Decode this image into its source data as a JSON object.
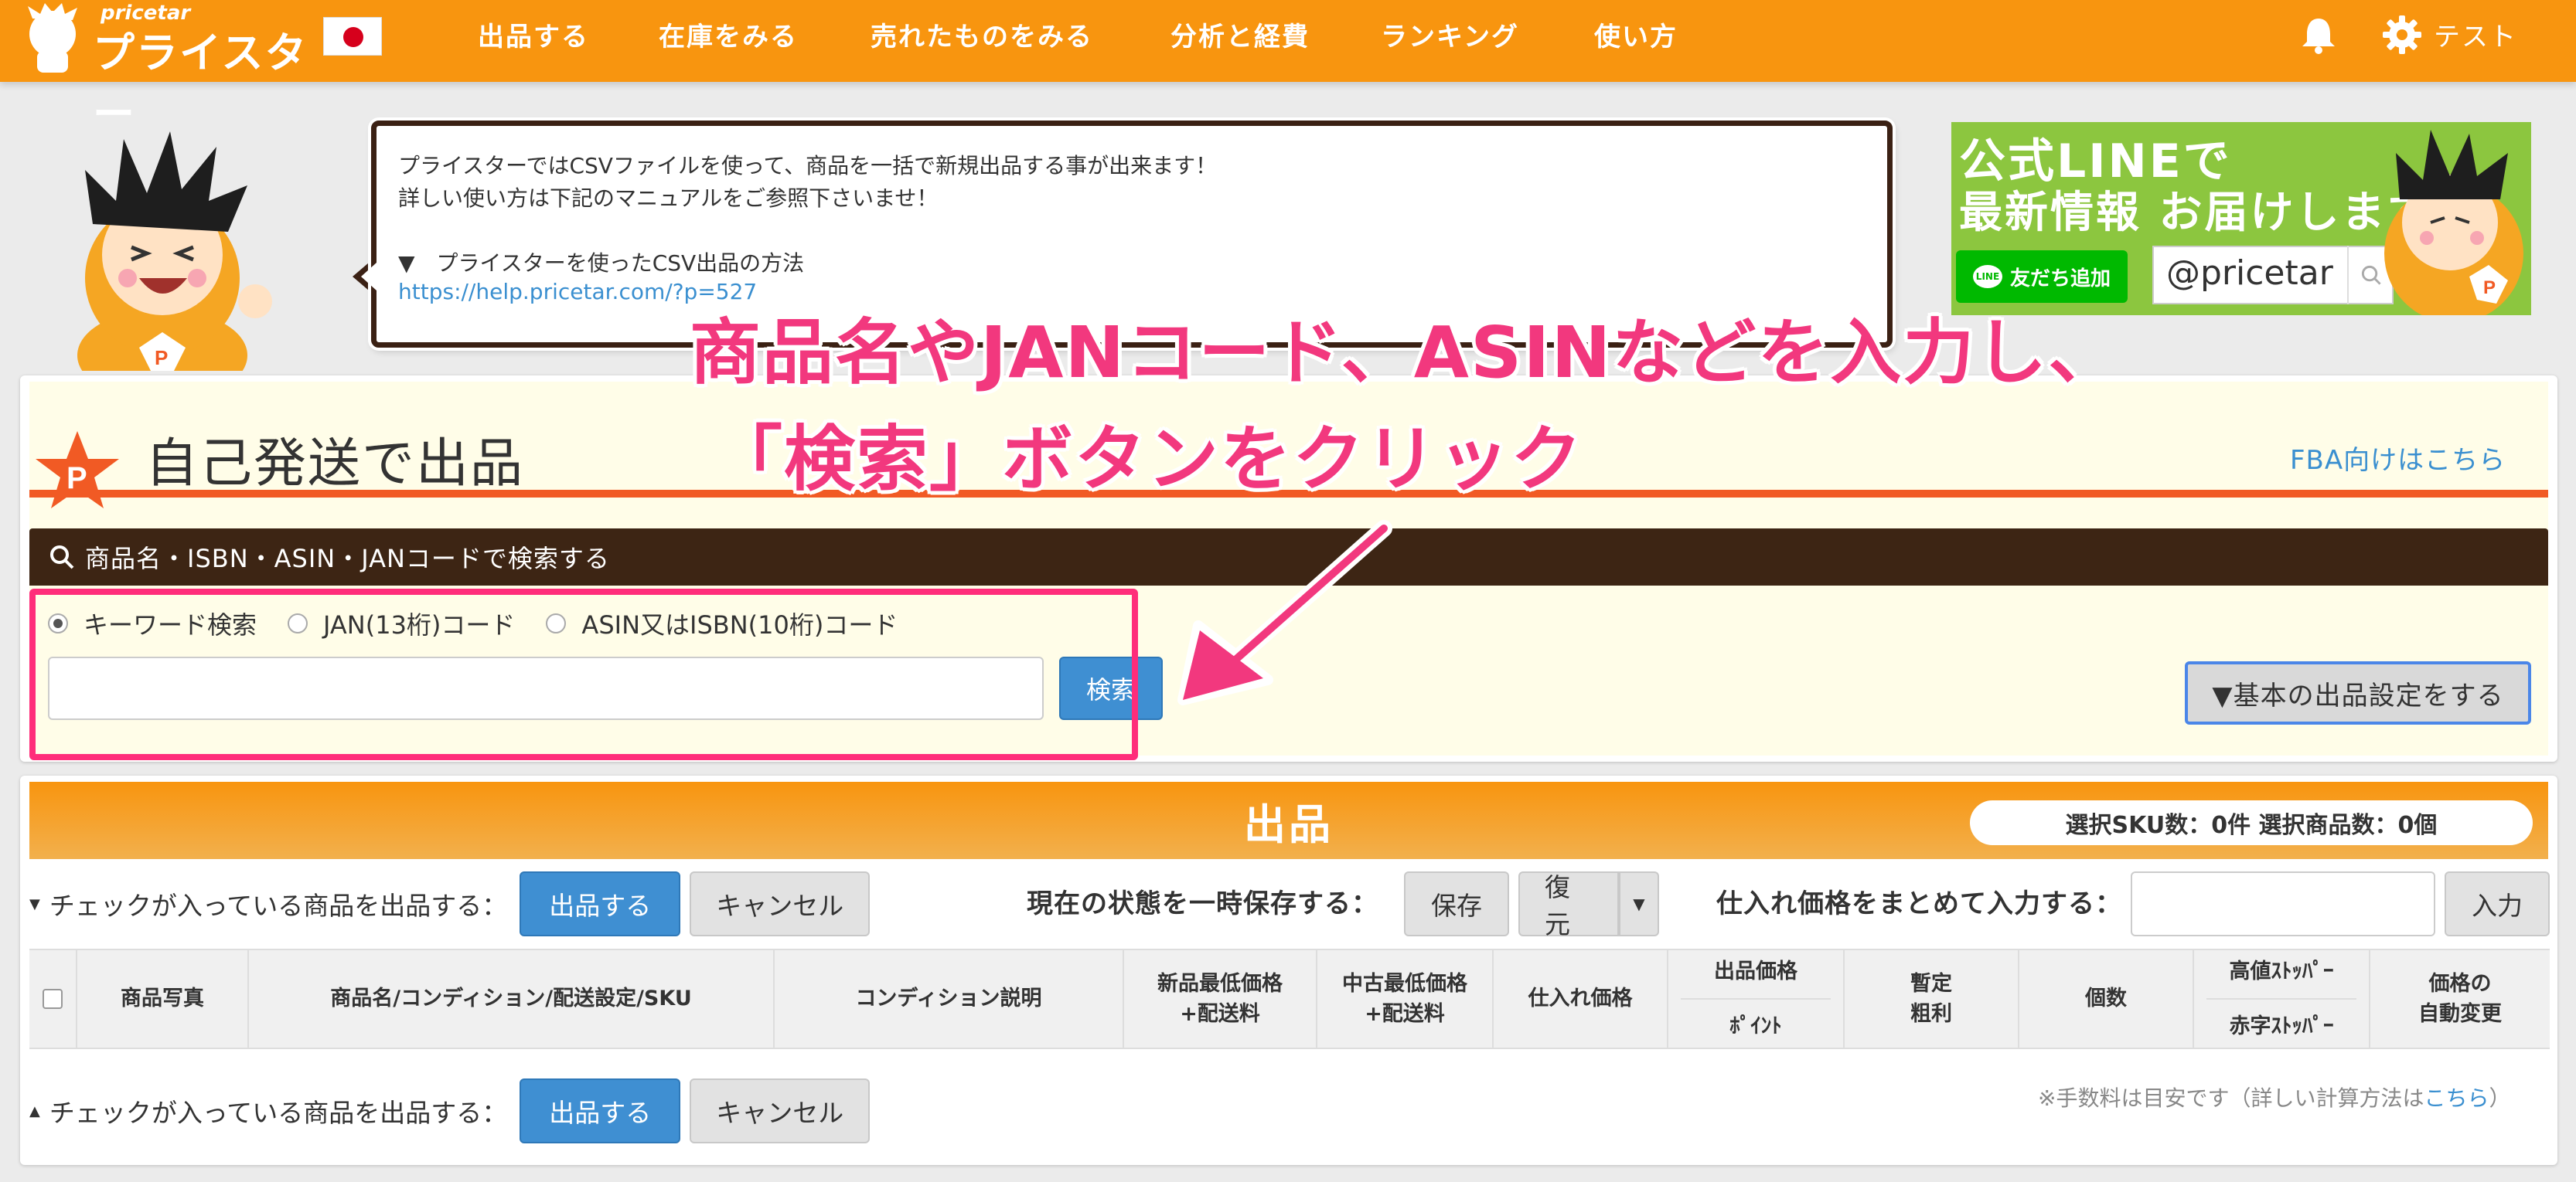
{
  "header": {
    "logo_small": "pricetar",
    "logo_big": "プライスター",
    "nav": [
      "出品する",
      "在庫をみる",
      "売れたものをみる",
      "分析と経費",
      "ランキング",
      "使い方"
    ],
    "user_name": "テスト"
  },
  "bubble": {
    "line1": "プライスターではCSVファイルを使って、商品を一括で新規出品する事が出来ます！",
    "line2": "詳しい使い方は下記のマニュアルをご参照下さいませ！",
    "line3": "▼　プライスターを使ったCSV出品の方法",
    "link": "https://help.pricetar.com/?p=527"
  },
  "line_banner": {
    "title1": "公式LINEで",
    "title2": "最新情報 お届けします！",
    "add_friend": "友だち追加",
    "line_badge": "LINE",
    "line_id": "@pricetar"
  },
  "main": {
    "title": "自己発送で出品",
    "fba_link": "FBA向けはこちら",
    "search_bar": "商品名・ISBN・ASIN・JANコードで検索する",
    "radios": [
      {
        "label": "キーワード検索",
        "checked": true
      },
      {
        "label": "JAN(13桁)コード",
        "checked": false
      },
      {
        "label": "ASIN又はISBN(10桁)コード",
        "checked": false
      }
    ],
    "search_value": "",
    "search_button": "検索",
    "settings_button": "▼基本の出品設定をする"
  },
  "annotation": {
    "line1": "商品名やJANコード、ASINなどを入力し、",
    "line2": "「検索」ボタンをクリック"
  },
  "listing": {
    "title": "出品",
    "sku_summary": "選択SKU数：0件 選択商品数：0個",
    "action_label": "チェックが入っている商品を出品する：",
    "list_button": "出品する",
    "cancel_button": "キャンセル",
    "save_label": "現在の状態を一時保存する：",
    "save_button": "保存",
    "restore_button": "復元",
    "cost_label": "仕入れ価格をまとめて入力する：",
    "cost_value": "",
    "cost_button": "入力",
    "columns": {
      "photo": "商品写真",
      "name": "商品名/コンディション/配送設定/SKU",
      "condition_note": "コンディション説明",
      "new_min_1": "新品最低価格",
      "new_min_2": "+配送料",
      "used_min_1": "中古最低価格",
      "used_min_2": "+配送料",
      "cost": "仕入れ価格",
      "price_1": "出品価格",
      "price_2": "ﾎﾟｲﾝﾄ",
      "profit_1": "暫定",
      "profit_2": "粗利",
      "qty": "個数",
      "stop_1": "高値ｽﾄｯﾊﾟｰ",
      "stop_2": "赤字ｽﾄｯﾊﾟｰ",
      "auto_1": "価格の",
      "auto_2": "自動変更"
    },
    "note_prefix": "※手数料は目安です（詳しい計算方法は",
    "note_link": "こちら",
    "note_suffix": "）"
  },
  "colors": {
    "header": "#f8950f",
    "brown": "#3d2514",
    "accent_blue": "#3f8fd2",
    "annotation_pink": "#f2387e",
    "line_green": "#8cc63f"
  }
}
